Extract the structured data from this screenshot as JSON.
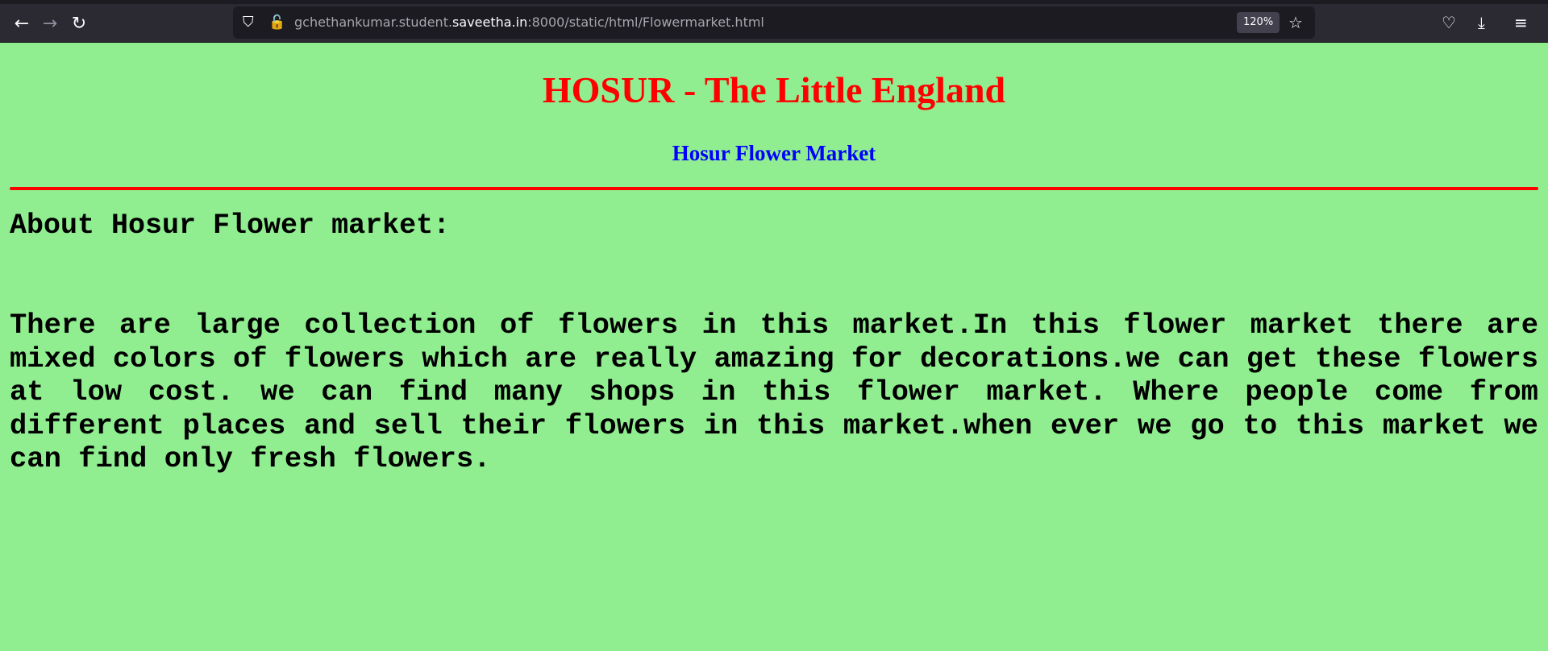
{
  "browser": {
    "url_host_prefix": "gchethankumar.student.",
    "url_host_domain": "saveetha.in",
    "url_rest": ":8000/static/html/Flowermarket.html",
    "zoom": "120%"
  },
  "page": {
    "title": "HOSUR - The Little England",
    "subtitle": "Hosur Flower Market",
    "section_heading": "About Hosur Flower market:",
    "paragraph": "There are large collection of flowers in this market.In this flower market there are mixed colors of flowers which are really amazing for decorations.we can get these flowers at low cost. we can find many shops in this flower market. Where people come from different places and sell their flowers in this market.when ever we go to this market we can find only fresh flowers.",
    "colors": {
      "background": "#90ee90",
      "title": "#ff0000",
      "subtitle": "#0000ff",
      "rule": "#ff0000"
    }
  }
}
